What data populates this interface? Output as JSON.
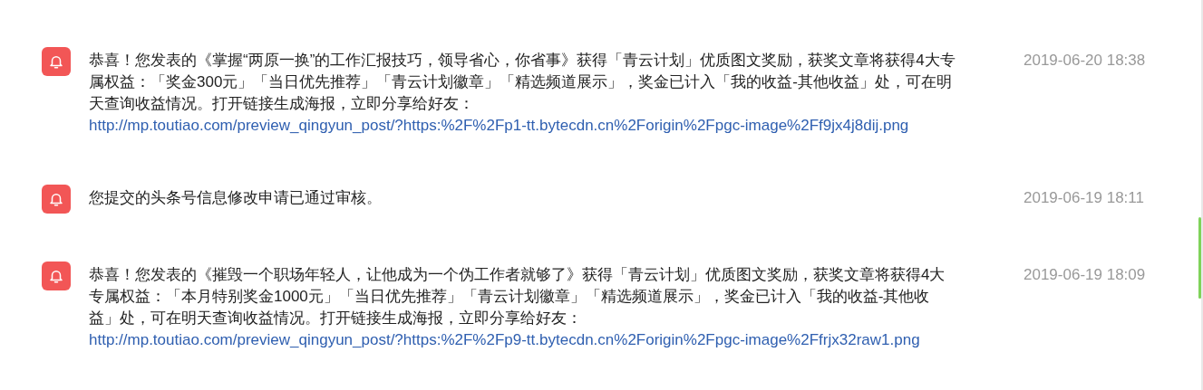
{
  "notifications": [
    {
      "text": "恭喜！您发表的《掌握“两原一换”的工作汇报技巧，领导省心，你省事》获得「青云计划」优质图文奖励，获奖文章将获得4大专属权益：「奖金300元」「当日优先推荐」「青云计划徽章」「精选频道展示」，奖金已计入「我的收益-其他收益」处，可在明天查询收益情况。打开链接生成海报，立即分享给好友：",
      "link": "http://mp.toutiao.com/preview_qingyun_post/?https:%2F%2Fp1-tt.bytecdn.cn%2Forigin%2Fpgc-image%2Ff9jx4j8dij.png",
      "time": "2019-06-20 18:38"
    },
    {
      "text": "您提交的头条号信息修改申请已通过审核。",
      "time": "2019-06-19 18:11"
    },
    {
      "text": "恭喜！您发表的《摧毁一个职场年轻人，让他成为一个伪工作者就够了》获得「青云计划」优质图文奖励，获奖文章将获得4大专属权益：「本月特别奖金1000元」「当日优先推荐」「青云计划徽章」「精选频道展示」，奖金已计入「我的收益-其他收益」处，可在明天查询收益情况。打开链接生成海报，立即分享给好友：",
      "link": "http://mp.toutiao.com/preview_qingyun_post/?https:%2F%2Fp9-tt.bytecdn.cn%2Forigin%2Fpgc-image%2Ffrjx32raw1.png",
      "time": "2019-06-19 18:09"
    }
  ]
}
